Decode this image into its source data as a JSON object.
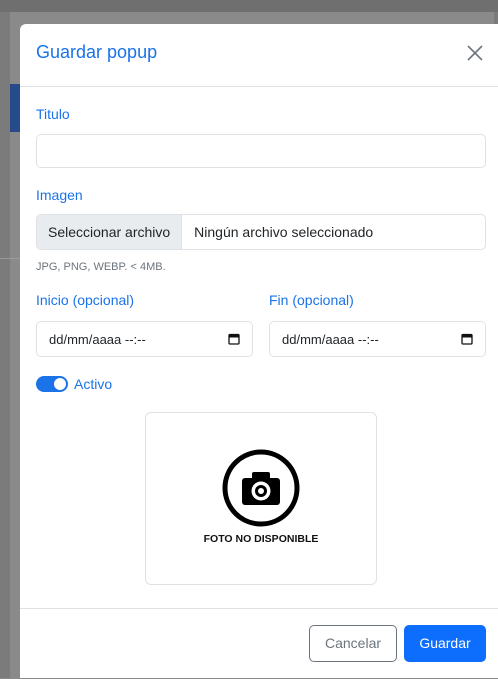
{
  "modal": {
    "title": "Guardar popup"
  },
  "form": {
    "titulo_label": "Titulo",
    "titulo_value": "",
    "imagen_label": "Imagen",
    "file_button": "Seleccionar archivo",
    "file_status": "Ningún archivo seleccionado",
    "file_help": "JPG, PNG, WEBP. < 4MB.",
    "inicio_label": "Inicio (opcional)",
    "inicio_value": "dd/mm/aaaa --:--",
    "fin_label": "Fin (opcional)",
    "fin_value": "dd/mm/aaaa --:--",
    "activo_label": "Activo",
    "activo_on": true
  },
  "preview": {
    "icon": "camera-icon",
    "text": "FOTO NO DISPONIBLE"
  },
  "footer": {
    "cancel_label": "Cancelar",
    "save_label": "Guardar"
  },
  "colors": {
    "accent": "#1a73e8",
    "primary_button": "#0d6efd",
    "secondary_button": "#6c757d",
    "border": "#dee2e6"
  }
}
